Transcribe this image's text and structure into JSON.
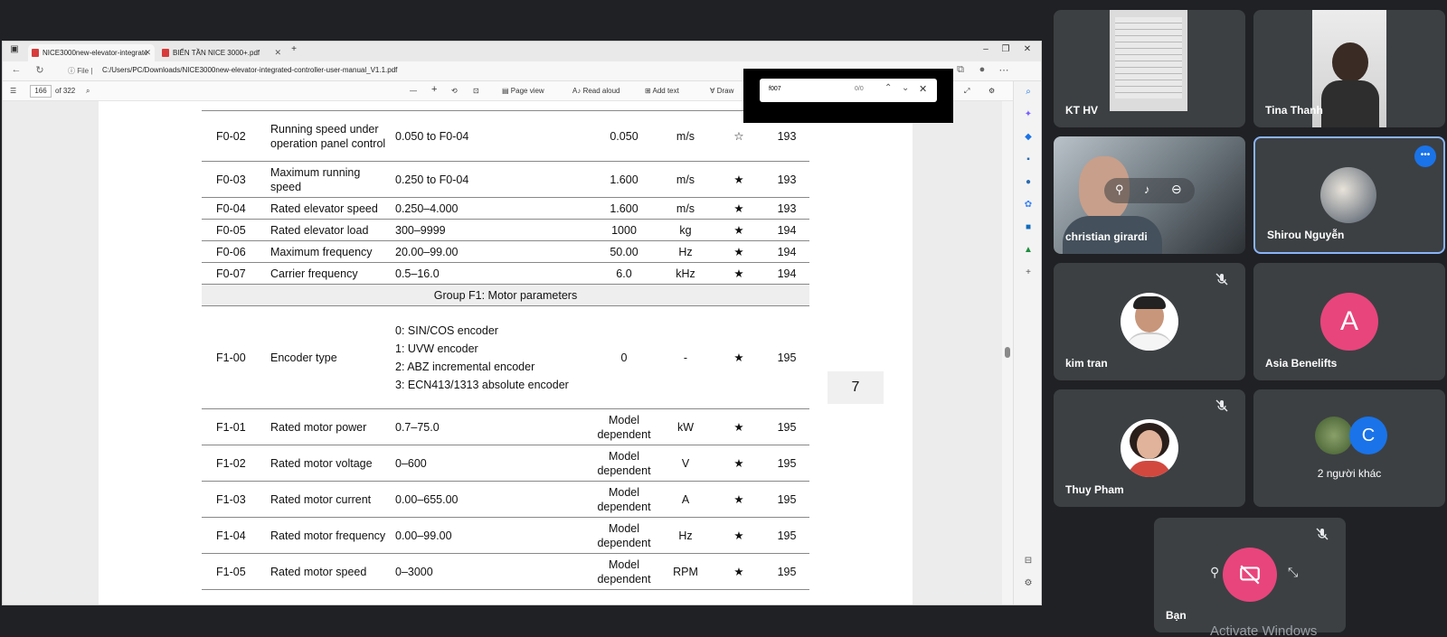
{
  "browser": {
    "tabs": [
      {
        "label": "NICE3000new-elevator-integrate"
      },
      {
        "label": "BIẾN TẦN NICE 3000+.pdf"
      }
    ],
    "file_label": "File",
    "url": "C:/Users/PC/Downloads/NICE3000new-elevator-integrated-controller-user-manual_V1.1.pdf"
  },
  "pdf_toolbar": {
    "page_number": "166",
    "page_total": "of 322",
    "minus": "—",
    "plus": "+",
    "page_view": "Page view",
    "read_aloud": "Read aloud",
    "add_text": "Add text",
    "draw": "Draw"
  },
  "find": {
    "query": "f007",
    "count": "0/0"
  },
  "page_badge": "7",
  "table": {
    "rows": [
      {
        "code": "F0-02",
        "name": "Running speed under operation panel control",
        "range": [
          "0.050 to F0-04"
        ],
        "default": "0.050",
        "unit": "m/s",
        "prop": "☆",
        "page": "193"
      },
      {
        "code": "F0-03",
        "name": "Maximum running speed",
        "range": [
          "0.250 to F0-04"
        ],
        "default": "1.600",
        "unit": "m/s",
        "prop": "★",
        "page": "193"
      },
      {
        "code": "F0-04",
        "name": "Rated elevator speed",
        "range": [
          "0.250–4.000"
        ],
        "default": "1.600",
        "unit": "m/s",
        "prop": "★",
        "page": "193"
      },
      {
        "code": "F0-05",
        "name": "Rated elevator load",
        "range": [
          "300–9999"
        ],
        "default": "1000",
        "unit": "kg",
        "prop": "★",
        "page": "194"
      },
      {
        "code": "F0-06",
        "name": "Maximum frequency",
        "range": [
          "20.00–99.00"
        ],
        "default": "50.00",
        "unit": "Hz",
        "prop": "★",
        "page": "194"
      },
      {
        "code": "F0-07",
        "name": "Carrier frequency",
        "range": [
          "0.5–16.0"
        ],
        "default": "6.0",
        "unit": "kHz",
        "prop": "★",
        "page": "194"
      },
      {
        "group": "Group F1: Motor parameters"
      },
      {
        "code": "F1-00",
        "name": "Encoder type",
        "range": [
          "0: SIN/COS encoder",
          "1: UVW encoder",
          "2: ABZ incremental encoder",
          "3: ECN413/1313 absolute encoder"
        ],
        "default": "0",
        "unit": "-",
        "prop": "★",
        "page": "195"
      },
      {
        "code": "F1-01",
        "name": "Rated motor power",
        "range": [
          "0.7–75.0"
        ],
        "default": "Model dependent",
        "unit": "kW",
        "prop": "★",
        "page": "195"
      },
      {
        "code": "F1-02",
        "name": "Rated motor voltage",
        "range": [
          "0–600"
        ],
        "default": "Model dependent",
        "unit": "V",
        "prop": "★",
        "page": "195"
      },
      {
        "code": "F1-03",
        "name": "Rated motor current",
        "range": [
          "0.00–655.00"
        ],
        "default": "Model dependent",
        "unit": "A",
        "prop": "★",
        "page": "195"
      },
      {
        "code": "F1-04",
        "name": "Rated motor frequency",
        "range": [
          "0.00–99.00"
        ],
        "default": "Model dependent",
        "unit": "Hz",
        "prop": "★",
        "page": "195"
      },
      {
        "code": "F1-05",
        "name": "Rated motor speed",
        "range": [
          "0–3000"
        ],
        "default": "Model dependent",
        "unit": "RPM",
        "prop": "★",
        "page": "195"
      }
    ]
  },
  "participants": {
    "kt_hv": "KT HV",
    "tina": "Tina Thanh",
    "christian": "christian girardi",
    "shirou": "Shirou Nguyễn",
    "kim": "kim tran",
    "asia": "Asia Benelifts",
    "asia_initial": "A",
    "thuy": "Thuy Pham",
    "others": "2 người khác",
    "others_initial": "C",
    "self": "Bạn",
    "more_dots": "•••"
  },
  "colors": {
    "meet_bg": "#202124",
    "tile_bg": "#3c4043",
    "asia_avatar": "#e8457c",
    "c_avatar": "#1a73e8",
    "active_border": "#8ab4f8",
    "self_button": "#e8457c"
  },
  "watermark": "Activate Windows"
}
